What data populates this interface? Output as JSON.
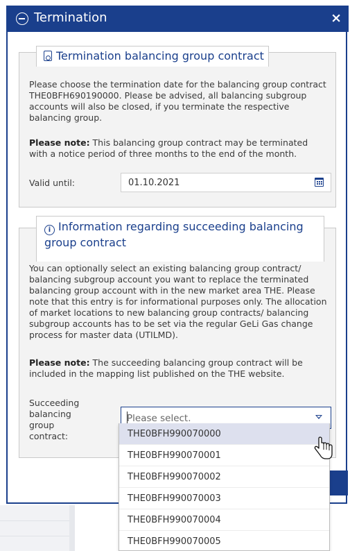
{
  "modal": {
    "title": "Termination",
    "close_label": "×"
  },
  "contract_panel": {
    "legend": "Termination balancing group contract",
    "description": "Please choose the termination date for the balancing group contract THE0BFH690190000. Please be advised, all balancing subgroup accounts will also be closed, if you terminate the respective balancing group.",
    "note_label": "Please note:",
    "note_text": " This balancing group contract may be terminated with a notice period of three months to the end of the month.",
    "valid_until_label": "Valid until:",
    "valid_until_value": "01.10.2021"
  },
  "succeeding_panel": {
    "legend": "Information regarding succeeding balancing group contract",
    "description": "You can optionally select an existing balancing group contract/ balancing subgroup account you want to replace the terminated balancing group account with in the new market area THE. Please note that this entry is for informational purposes only. The allocation of market locations to new balancing group contracts/ balancing subgroup accounts has to be set via the regular GeLi Gas change process for master data (UTILMD).",
    "note_label": "Please note:",
    "note_text": " The succeeding balancing group contract will be included in the mapping list published on the THE website.",
    "select_label": "Succeeding balancing group contract:",
    "select_placeholder": "Please select."
  },
  "dropdown": {
    "options": [
      "THE0BFH990070000",
      "THE0BFH990070001",
      "THE0BFH990070002",
      "THE0BFH990070003",
      "THE0BFH990070004",
      "THE0BFH990070005"
    ],
    "hovered_index": 0
  },
  "colors": {
    "primary": "#1a3f8c",
    "panel_bg": "#f3f3f3",
    "hover_bg": "#dde0ee"
  }
}
